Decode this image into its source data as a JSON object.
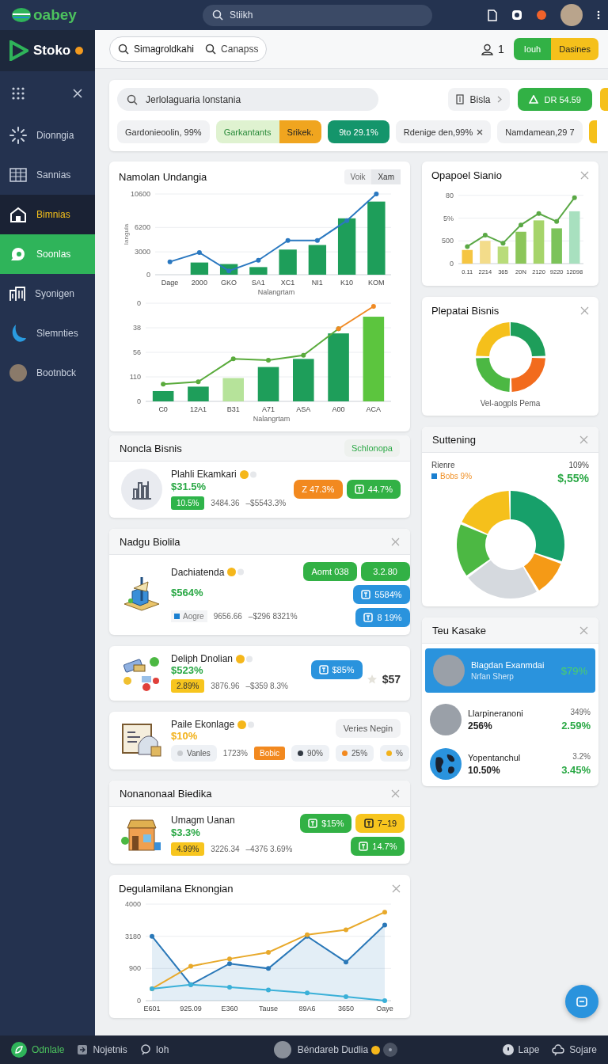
{
  "topbar": {
    "logo": "oabey",
    "search": {
      "placeholder": "Stiikh"
    }
  },
  "sidebar": {
    "brand": "Stoko",
    "items": [
      {
        "label": "Dionngia",
        "selected": false,
        "highlighted": false
      },
      {
        "label": "Sannias",
        "selected": false,
        "highlighted": false
      },
      {
        "label": "Bimnias",
        "selected": false,
        "highlighted": true
      },
      {
        "label": "Soonlas",
        "selected": true,
        "highlighted": false
      },
      {
        "label": "Syonigen",
        "selected": false,
        "highlighted": false
      },
      {
        "label": "Slemnties",
        "selected": false,
        "highlighted": false
      },
      {
        "label": "Bootnbck",
        "selected": false,
        "highlighted": false
      }
    ]
  },
  "header": {
    "search_tabs": [
      {
        "label": "Simagroldkahi",
        "selected": true
      },
      {
        "label": "Canapss",
        "selected": false
      }
    ],
    "user_count": "1",
    "split_button": [
      "Iouh",
      "Dasines"
    ]
  },
  "filter": {
    "search": {
      "placeholder": "Jerlolaguaria lonstania"
    },
    "dropdown": "Bisla",
    "action": "DR 54.59",
    "chips": [
      {
        "kind": "plain",
        "label": "Gardonieoolin, 99%"
      },
      {
        "kind": "split",
        "label": "Garkantants",
        "extra": "Srikek."
      },
      {
        "kind": "solid",
        "label": "9to 29.1%"
      },
      {
        "kind": "removable",
        "label": "Rdenige den,99%"
      },
      {
        "kind": "plain",
        "label": "Namdamean,29 7"
      }
    ]
  },
  "chart_card": {
    "title": "Namolan Undangia",
    "toggle": [
      {
        "label": "Voik",
        "selected": false
      },
      {
        "label": "Xam",
        "selected": true
      }
    ],
    "chart_data": {
      "type": "bar",
      "grid": true,
      "xlabel": "Nalangrtam",
      "ylabel": "Iangula",
      "categories": [
        "Dage",
        "2000",
        "GKO",
        "SA1",
        "XC1",
        "NI1",
        "K10",
        "KOM"
      ],
      "ylim": [
        0,
        10600
      ],
      "yticks": [
        0,
        3000,
        6200,
        10600
      ],
      "series": [
        {
          "type": "bar",
          "color": "#1e9e5a",
          "values": [
            null,
            1600,
            1400,
            1000,
            3300,
            3900,
            7400,
            9600
          ]
        },
        {
          "type": "line",
          "color": "#2a78c0",
          "marker": "o",
          "values": [
            1700,
            2900,
            500,
            1900,
            4500,
            4500,
            7100,
            10600
          ]
        }
      ]
    },
    "second_chart": {
      "axis_title": "Nalangrtam",
      "y_labels": [
        "0",
        "38",
        "56",
        "110",
        "0"
      ],
      "x_labels": [
        "C0",
        "12A1",
        "B31",
        "A71",
        "ASA",
        "A00",
        "ACA"
      ]
    }
  },
  "item_cards": [
    {
      "title": "Noncla Bisnis",
      "action": "Schlonopa",
      "rows": [
        {
          "kind": "chart",
          "name": "Plahli Ekamkari",
          "verified": true,
          "value": {
            "text": "$31.5%",
            "color": "#2aa845"
          },
          "stats": [
            {
              "kind": "tag",
              "label": "10.5%",
              "color": "#2fb44a"
            },
            {
              "kind": "text",
              "label": "3484.36"
            },
            {
              "kind": "text",
              "label": "–$5543.3%"
            }
          ],
          "actions": [
            {
              "kind": "solid",
              "label": "Z 47.3%",
              "color": "#f2891f",
              "icon": false
            },
            {
              "kind": "solid",
              "label": "44.7%",
              "color": "#32b145",
              "icon": true
            }
          ]
        }
      ]
    },
    {
      "title": "Nadgu Biolila",
      "closable": true,
      "rows": [
        {
          "kind": "tower",
          "name": "Dachiatenda",
          "verified": true,
          "value": {
            "text": "$564%",
            "color": "#2aa845"
          },
          "stats": [
            {
              "kind": "legend",
              "label": "Aogre",
              "color": "#1a7fd0"
            },
            {
              "kind": "text",
              "label": "9656.66"
            },
            {
              "kind": "text",
              "label": "–$296 8321%"
            }
          ],
          "actions": [
            {
              "kind": "solid",
              "label": "Aomt 038",
              "color": "#32b145",
              "icon": false
            },
            {
              "kind": "solid",
              "label": "3.2.80",
              "color": "#32b145",
              "icon": false
            },
            {
              "kind": "solid",
              "label": "5584%",
              "color": "#2a93dd",
              "icon": true
            },
            {
              "kind": "solid",
              "label": "8 19%",
              "color": "#2a93dd",
              "icon": true
            }
          ]
        }
      ]
    },
    {
      "rows": [
        {
          "kind": "parts",
          "name": "Deliph Dnolian",
          "verified": true,
          "value": {
            "text": "$523%",
            "color": "#2aa845"
          },
          "stats": [
            {
              "kind": "tag",
              "label": "2.89%",
              "color": "#f7c51e"
            },
            {
              "kind": "text",
              "label": "3876.96"
            },
            {
              "kind": "text",
              "label": "–$359 8.3%"
            }
          ],
          "actions": [
            {
              "kind": "solid",
              "label": "$85%",
              "color": "#2a93dd",
              "icon": true
            }
          ],
          "price": "$57"
        }
      ]
    },
    {
      "rows": [
        {
          "kind": "document",
          "name": "Paile Ekonlage",
          "verified": true,
          "value": {
            "text": "$10%",
            "color": "#f2b21c"
          },
          "stats": [
            {
              "kind": "chip",
              "label": "Vanles",
              "color": "#c9ccd0"
            },
            {
              "kind": "text",
              "label": "1723%"
            },
            {
              "kind": "tag",
              "label": "Bobic",
              "color": "#f2891f"
            },
            {
              "kind": "chip",
              "label": "90%",
              "color": "#333a44"
            },
            {
              "kind": "chip",
              "label": "25%",
              "color": "#f2891f"
            },
            {
              "kind": "chip",
              "label": "%",
              "color": "#f2b21c"
            }
          ],
          "actions": [
            {
              "kind": "plain",
              "label": "Veries Negin",
              "color": "#f1f2f4",
              "icon": false
            }
          ]
        }
      ]
    },
    {
      "title": "Nonanonaal Biedika",
      "closable": true,
      "rows": [
        {
          "kind": "shop",
          "name": "Umagm Uanan",
          "verified": false,
          "value": {
            "text": "$3.3%",
            "color": "#2aa845"
          },
          "stats": [
            {
              "kind": "tag",
              "label": "4.99%",
              "color": "#f7c51e"
            },
            {
              "kind": "text",
              "label": "3226.34"
            },
            {
              "kind": "text",
              "label": "–4376 3.69%"
            }
          ],
          "actions": [
            {
              "kind": "solid",
              "label": "$15%",
              "color": "#32b145",
              "icon": true
            },
            {
              "kind": "solid",
              "label": "7–19",
              "color": "#f7c51e",
              "icon": true
            },
            {
              "kind": "solid",
              "label": "14.7%",
              "color": "#32b145",
              "icon": true
            }
          ]
        }
      ]
    }
  ],
  "trend_card": {
    "title": "Degulamilana Eknongian",
    "closable": true,
    "y_labels": [
      "4000",
      "3180",
      "900",
      "0"
    ],
    "x_labels": [
      "E601",
      "925.09",
      "E360",
      "Tause",
      "89A6",
      "3650",
      "Oaye"
    ]
  },
  "bar_card": {
    "title": "Opapoel Sianio",
    "closable": true,
    "y_labels": [
      "80",
      "5%",
      "500",
      "0"
    ],
    "x_labels": [
      "0.11",
      "2214",
      "365",
      "20N",
      "2120",
      "9220",
      "12098"
    ]
  },
  "donut_card": {
    "title": "Plepatai Bisnis",
    "closable": true,
    "caption": "Vel-aogpls Pema"
  },
  "share_card": {
    "title": "Suttening",
    "closable": true,
    "label": "Rienre",
    "legend": {
      "label": "Bobs 9%",
      "color": "#1a7fd0"
    },
    "total": "109%",
    "value": "$,55%"
  },
  "list_card": {
    "title": "Teu Kasake",
    "closable": true,
    "items": [
      {
        "kind": "photo",
        "name": "Blagdan Exanmdai",
        "detail": "Nrfan Sherp",
        "figures": [
          "$79%"
        ],
        "selected": true
      },
      {
        "kind": "photo",
        "name": "Llarpineranoni",
        "detail": "256%",
        "figures": [
          "349%",
          "2.59%"
        ],
        "selected": false
      },
      {
        "kind": "globe",
        "name": "Yopentanchul",
        "detail": "10.50%",
        "figures": [
          "3.2%",
          "3.45%"
        ],
        "selected": false
      }
    ]
  },
  "bottom_bar": {
    "left": [
      {
        "label": "Odnlale"
      },
      {
        "label": "Nojetnis"
      },
      {
        "label": "Ioh"
      }
    ],
    "user": "Béndareb Dudlia",
    "right": [
      {
        "label": "Lape"
      },
      {
        "label": "Sojare"
      }
    ]
  }
}
